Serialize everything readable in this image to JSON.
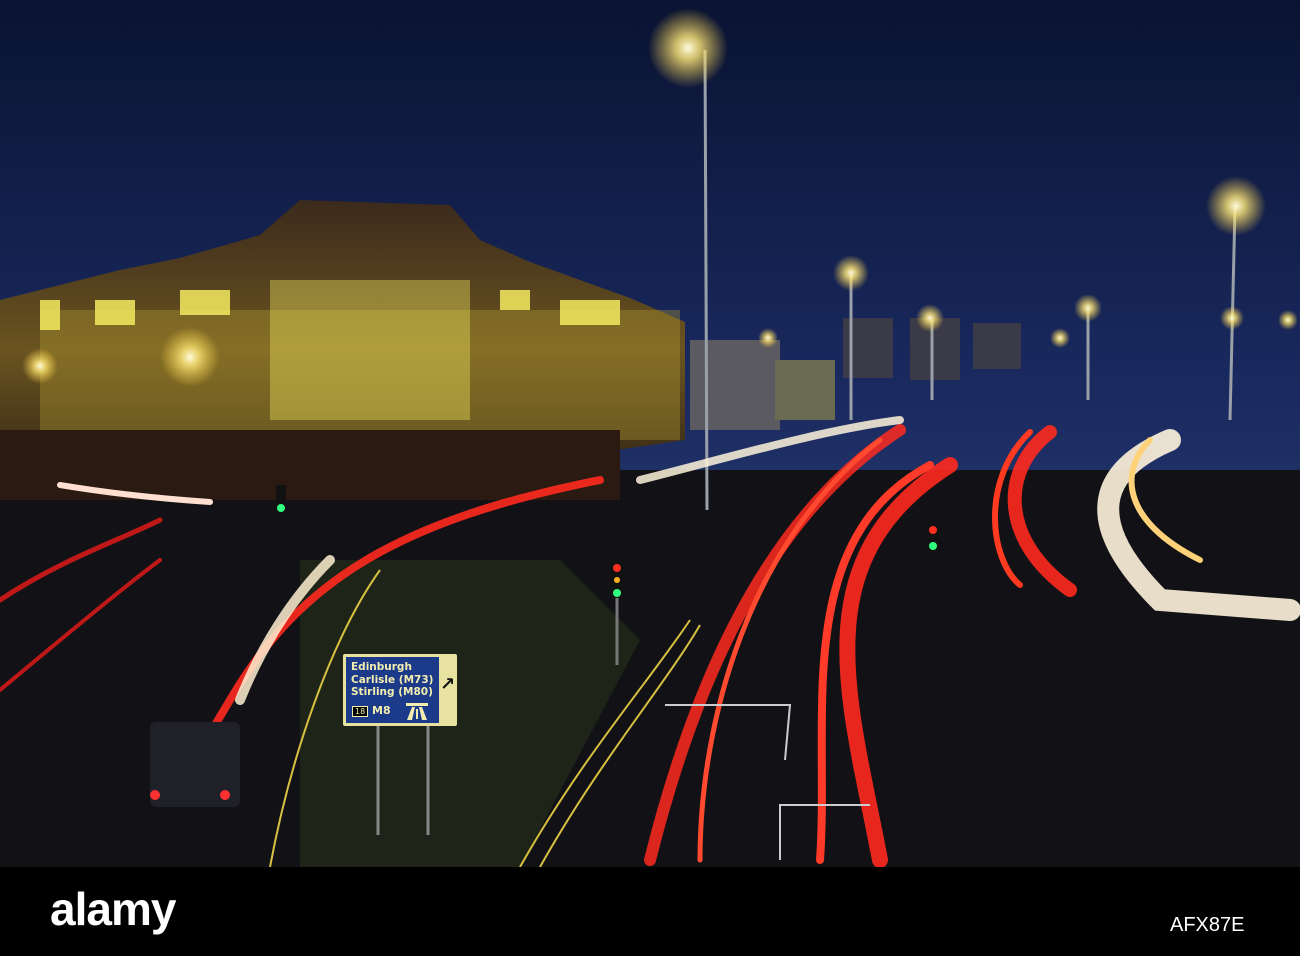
{
  "sign": {
    "lines": [
      "Edinburgh",
      "Carlisle (M73)",
      "Stirling (M80)"
    ],
    "junction": "18",
    "motorway": "M8",
    "arrow": "arrow-up-right-icon"
  },
  "watermark": {
    "logo": "alamy",
    "image_id": "AFX87E"
  },
  "colors": {
    "sky_top": "#0b1538",
    "sky_bottom": "#2a3c78",
    "trail_red": "#ff2a1e",
    "trail_white": "#fff4dc",
    "building_light": "#f0e85a",
    "sign_blue": "#1c3a8a"
  }
}
